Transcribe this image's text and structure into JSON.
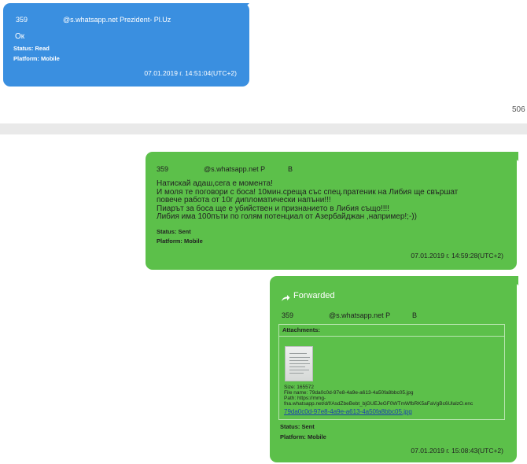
{
  "messages": [
    {
      "sender_prefix": "359",
      "sender_rest": "@s.whatsapp.net Prezident- Pl.Uz",
      "body": "Ок",
      "status": "Status: Read",
      "platform": "Platform: Mobile",
      "timestamp": "07.01.2019 г. 14:51:04(UTC+2)"
    },
    {
      "sender_prefix": "359",
      "sender_rest": "@s.whatsapp.net P",
      "sender_suffix": "B",
      "body": "Натискай адаш,сега е момента!\nИ моля те поговори с боса! 10мин.среща със спец.пратеник на Либия ще свършат\nповече работа от 10г дипломатически напъни!!!\nПиарът за боса ще е убийствен и признанието в Либия също!!!!\nЛибия има 100пъти по голям потенциал от Азербайджан ,например!;-))",
      "status": "Status: Sent",
      "platform": "Platform: Mobile",
      "timestamp": "07.01.2019 г. 14:59:28(UTC+2)"
    },
    {
      "forwarded_label": "Forwarded",
      "sender_prefix": "359",
      "sender_rest": "@s.whatsapp.net P",
      "sender_suffix": "B",
      "attachments_label": "Attachments:",
      "attachment": {
        "size": "Size: 165572",
        "file_name": "File name: 79da0c0d-97e8-4a9e-a613-4a50fa8bbc05.jpg",
        "path_label": "Path: https://mmg-",
        "path_value": "fna.whatsapp.net/d/f/AsdZbeBebt_bjGUEJeGF0WTmWfbRK5aFaVgBc6UlalzO.enc",
        "link": "79da0c0d-97e8-4a9e-a613-4a50fa8bbc05.jpg"
      },
      "status": "Status: Sent",
      "platform": "Platform: Mobile",
      "timestamp": "07.01.2019 г. 15:08:43(UTC+2)"
    }
  ],
  "page_number": "506",
  "colors": {
    "received": "#3a8fe0",
    "sent": "#5cc04a"
  },
  "icons": {
    "forwarded": "forward-arrow-icon",
    "attachment": "image-thumbnail"
  }
}
